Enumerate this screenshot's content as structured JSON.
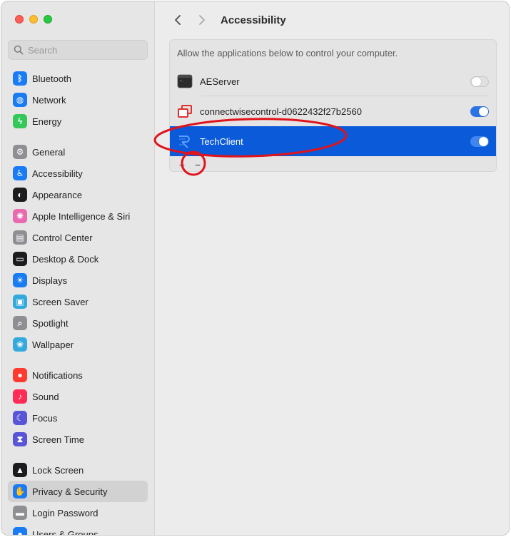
{
  "sidebar": {
    "search_placeholder": "Search",
    "groups": [
      [
        {
          "label": "Bluetooth",
          "icon": "bluetooth-icon",
          "color": "#1a7cf5"
        },
        {
          "label": "Network",
          "icon": "network-icon",
          "color": "#1a7cf5"
        },
        {
          "label": "Energy",
          "icon": "energy-icon",
          "color": "#34c759"
        }
      ],
      [
        {
          "label": "General",
          "icon": "gear-icon",
          "color": "#8e8e93"
        },
        {
          "label": "Accessibility",
          "icon": "accessibility-icon",
          "color": "#1a7cf5"
        },
        {
          "label": "Appearance",
          "icon": "appearance-icon",
          "color": "#1c1c1e"
        },
        {
          "label": "Apple Intelligence & Siri",
          "icon": "siri-icon",
          "color": "#e86bb0"
        },
        {
          "label": "Control Center",
          "icon": "control-center-icon",
          "color": "#8e8e93"
        },
        {
          "label": "Desktop & Dock",
          "icon": "dock-icon",
          "color": "#1c1c1e"
        },
        {
          "label": "Displays",
          "icon": "displays-icon",
          "color": "#1a7cf5"
        },
        {
          "label": "Screen Saver",
          "icon": "screen-saver-icon",
          "color": "#34aadc"
        },
        {
          "label": "Spotlight",
          "icon": "spotlight-icon",
          "color": "#8e8e93"
        },
        {
          "label": "Wallpaper",
          "icon": "wallpaper-icon",
          "color": "#34aadc"
        }
      ],
      [
        {
          "label": "Notifications",
          "icon": "notifications-icon",
          "color": "#ff3b30"
        },
        {
          "label": "Sound",
          "icon": "sound-icon",
          "color": "#ff2d55"
        },
        {
          "label": "Focus",
          "icon": "focus-icon",
          "color": "#5856d6"
        },
        {
          "label": "Screen Time",
          "icon": "screen-time-icon",
          "color": "#5856d6"
        }
      ],
      [
        {
          "label": "Lock Screen",
          "icon": "lock-icon",
          "color": "#1c1c1e"
        },
        {
          "label": "Privacy & Security",
          "icon": "privacy-hand-icon",
          "color": "#1a7cf5",
          "selected": true
        },
        {
          "label": "Login Password",
          "icon": "login-password-icon",
          "color": "#8e8e93"
        },
        {
          "label": "Users & Groups",
          "icon": "users-icon",
          "color": "#1a7cf5"
        }
      ]
    ]
  },
  "main": {
    "title": "Accessibility",
    "description": "Allow the applications below to control your computer.",
    "apps": [
      {
        "name": "AEServer",
        "enabled": false,
        "icon": "terminal-icon"
      },
      {
        "name": "connectwisecontrol-d0622432f27b2560",
        "enabled": true,
        "icon": "connectwise-icon"
      },
      {
        "name": "TechClient",
        "enabled": true,
        "icon": "techclient-icon",
        "selected": true
      }
    ],
    "add_label": "+",
    "remove_label": "−"
  },
  "colors": {
    "accent": "#0a5ad9",
    "annotation": "#e0141c"
  }
}
